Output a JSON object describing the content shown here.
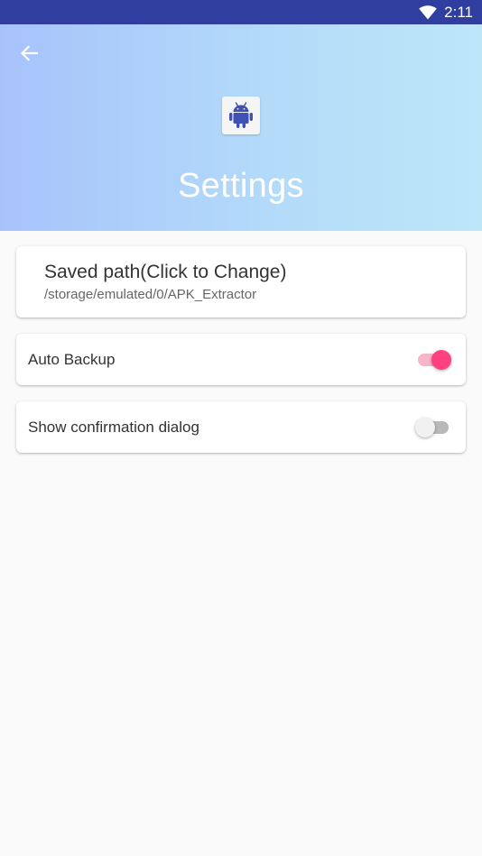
{
  "status_bar": {
    "time": "2:11",
    "icons": [
      "wifi-icon"
    ]
  },
  "header": {
    "title": "Settings",
    "back_icon": "arrow-left-icon",
    "app_icon": "android-icon",
    "gradient": [
      "#a7c3fb",
      "#bde6f9"
    ]
  },
  "settings": {
    "saved_path": {
      "title": "Saved path(Click to Change)",
      "value": "/storage/emulated/0/APK_Extractor"
    },
    "auto_backup": {
      "label": "Auto Backup",
      "enabled": true
    },
    "confirmation_dialog": {
      "label": "Show confirmation dialog",
      "enabled": false
    }
  },
  "colors": {
    "status_bar": "#303f9f",
    "accent": "#ff4081",
    "android_icon": "#3f51b5"
  }
}
